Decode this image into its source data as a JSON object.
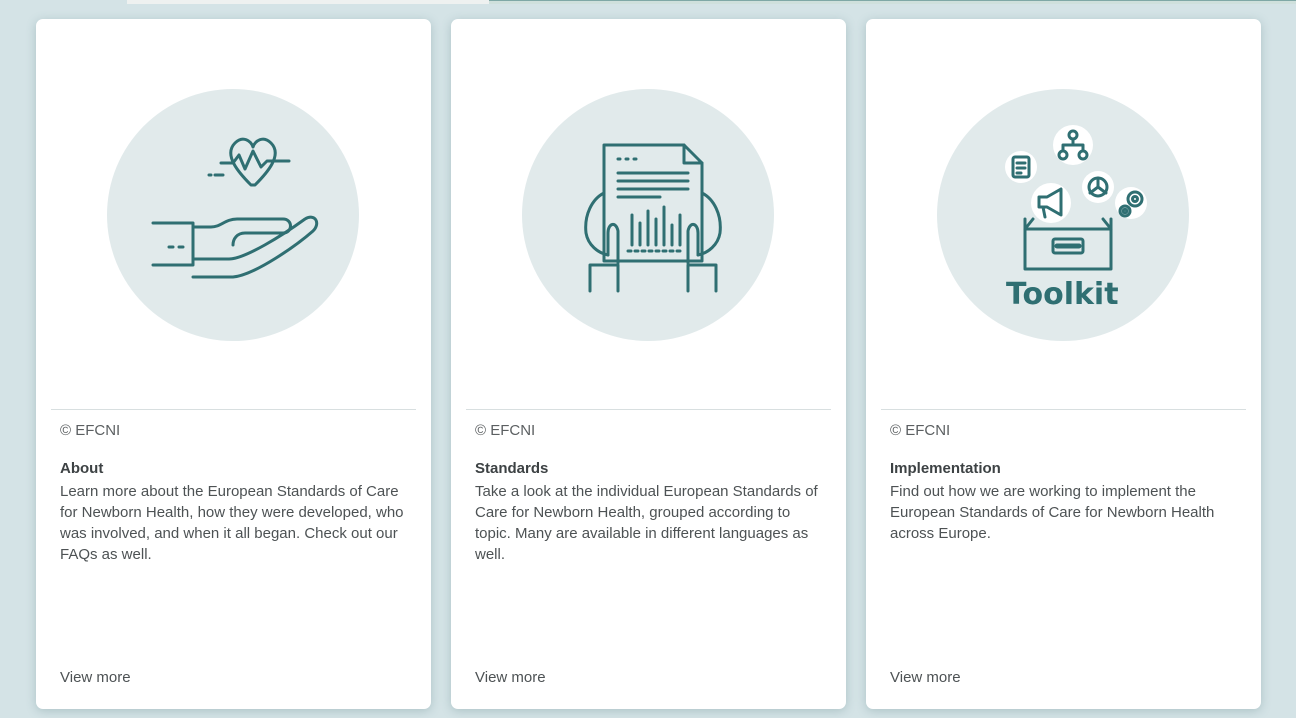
{
  "cards": [
    {
      "icon": "heart-hand-icon",
      "credit": "© EFCNI",
      "title": "About",
      "description": "Learn more about the European Standards of Care for Newborn Health, how they were developed, who was involved, and when it all began. Check out our FAQs as well.",
      "link": "View more"
    },
    {
      "icon": "document-chart-icon",
      "credit": "© EFCNI",
      "title": "Standards",
      "description": "Take a look at the individual European Standards of Care for Newborn Health, grouped according to topic. Many are available in different languages as well.",
      "link": "View more"
    },
    {
      "icon": "toolkit-box-icon",
      "icon_label": "Toolkit",
      "credit": "© EFCNI",
      "title": "Implementation",
      "description": "Find out how we are working to implement the European Standards of Care for Newborn Health across Europe.",
      "link": "View more"
    }
  ],
  "colors": {
    "icon_stroke": "#2f6f72",
    "circle": "#e1eaeb",
    "background": "#d4e3e6"
  }
}
